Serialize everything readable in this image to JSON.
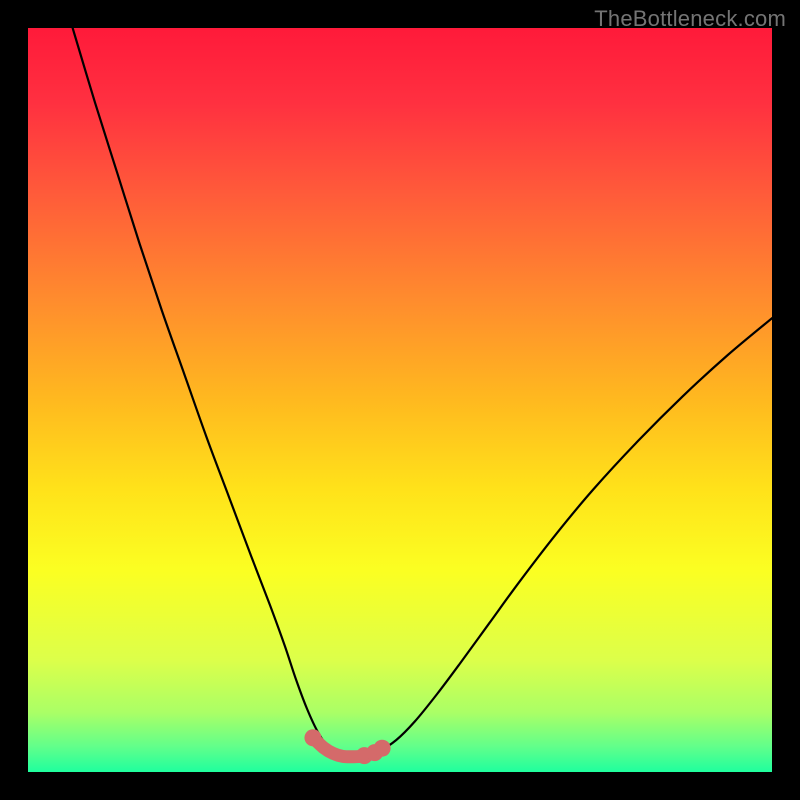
{
  "watermark": "TheBottleneck.com",
  "colors": {
    "frame_bg": "#000000",
    "curve": "#000000",
    "highlight": "#d46a6a",
    "watermark": "#747474"
  },
  "gradient_stops": [
    {
      "offset": 0.0,
      "color": "#ff1a3a"
    },
    {
      "offset": 0.1,
      "color": "#ff3040"
    },
    {
      "offset": 0.22,
      "color": "#ff5a3a"
    },
    {
      "offset": 0.36,
      "color": "#ff8a2e"
    },
    {
      "offset": 0.5,
      "color": "#ffb91f"
    },
    {
      "offset": 0.62,
      "color": "#ffe21a"
    },
    {
      "offset": 0.73,
      "color": "#fbff22"
    },
    {
      "offset": 0.85,
      "color": "#dcff4a"
    },
    {
      "offset": 0.92,
      "color": "#aaff66"
    },
    {
      "offset": 0.965,
      "color": "#63ff8a"
    },
    {
      "offset": 1.0,
      "color": "#1fff9e"
    }
  ],
  "chart_data": {
    "type": "line",
    "title": "",
    "xlabel": "",
    "ylabel": "",
    "xlim": [
      0,
      100
    ],
    "ylim": [
      0,
      100
    ],
    "series": [
      {
        "name": "bottleneck-curve",
        "x": [
          6,
          9,
          12,
          15,
          18,
          21,
          24,
          27,
          30,
          32.5,
          34.5,
          36,
          37.5,
          39,
          40.5,
          42.3,
          44.5,
          47,
          49.5,
          52,
          55,
          58,
          62,
          66,
          71,
          76,
          82,
          88,
          94,
          100
        ],
        "y": [
          100,
          90,
          80.5,
          71,
          62,
          53.5,
          45,
          37,
          29,
          22.5,
          17,
          12.5,
          8.5,
          5.3,
          3.2,
          2.1,
          2.05,
          2.7,
          4.3,
          6.8,
          10.5,
          14.5,
          20,
          25.5,
          32,
          38,
          44.5,
          50.5,
          56,
          61
        ]
      }
    ],
    "highlight": {
      "name": "optimal-zone",
      "x": [
        38.3,
        39.7,
        41,
        42.3,
        43.7,
        45,
        46.3,
        47.5
      ],
      "y": [
        4.6,
        3.3,
        2.5,
        2.1,
        2.05,
        2.15,
        2.5,
        3.1
      ],
      "dot_x": [
        38.3,
        45.2,
        46.6,
        47.6
      ],
      "dot_y": [
        4.6,
        2.2,
        2.6,
        3.2
      ]
    }
  }
}
